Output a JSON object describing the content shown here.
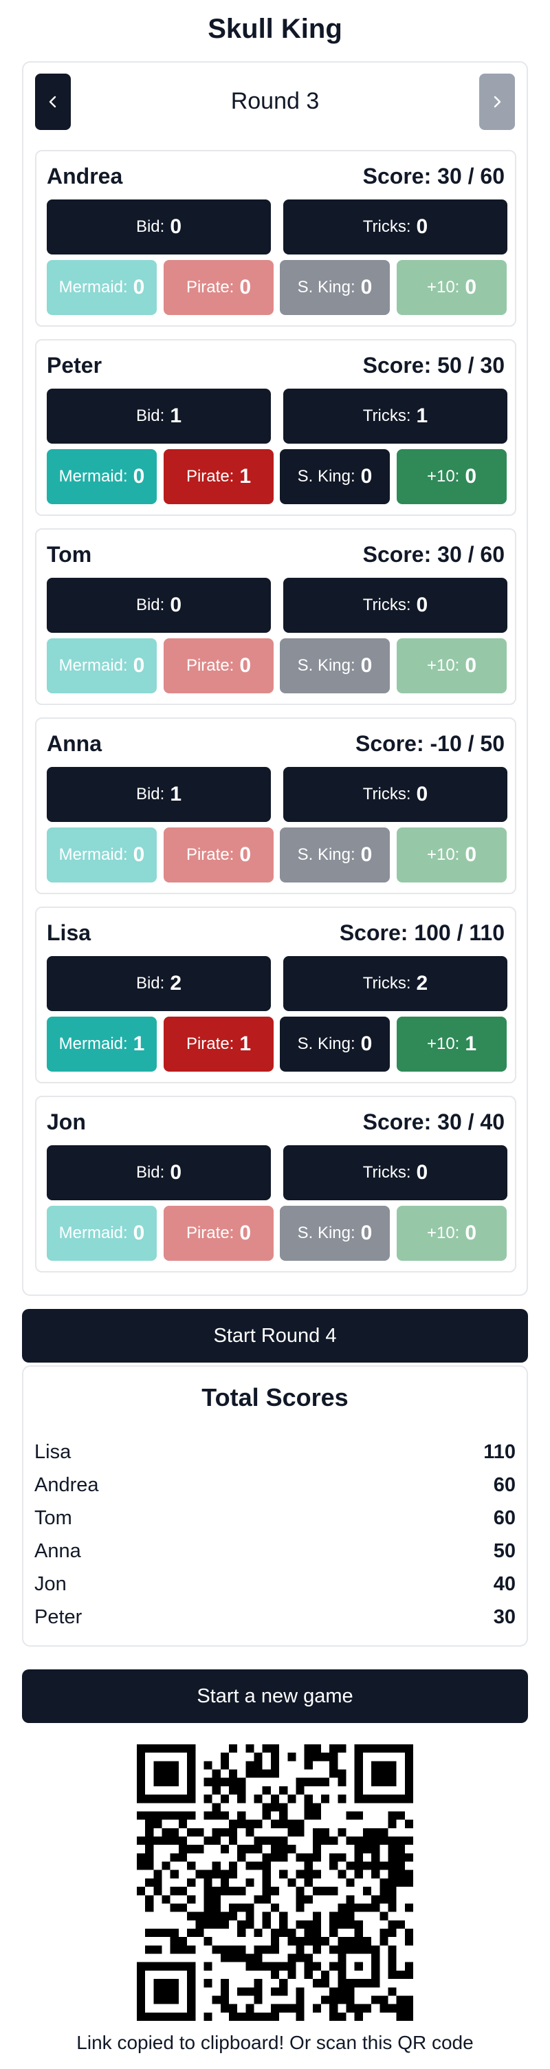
{
  "app": {
    "title": "Skull King"
  },
  "round": {
    "title": "Round 3",
    "prev_icon": "chevron-left-icon",
    "next_icon": "chevron-right-icon"
  },
  "labels": {
    "bid": "Bid:",
    "tricks": "Tricks:",
    "mermaid": "Mermaid:",
    "pirate": "Pirate:",
    "sking": "S. King:",
    "plus10": "+10:"
  },
  "players": [
    {
      "name": "Andrea",
      "score": "Score: 30 / 60",
      "bid": "0",
      "tricks": "0",
      "mermaid": "0",
      "pirate": "0",
      "sking": "0",
      "plus10": "0"
    },
    {
      "name": "Peter",
      "score": "Score: 50 / 30",
      "bid": "1",
      "tricks": "1",
      "mermaid": "0",
      "pirate": "1",
      "sking": "0",
      "plus10": "0"
    },
    {
      "name": "Tom",
      "score": "Score: 30 / 60",
      "bid": "0",
      "tricks": "0",
      "mermaid": "0",
      "pirate": "0",
      "sking": "0",
      "plus10": "0"
    },
    {
      "name": "Anna",
      "score": "Score: -10 / 50",
      "bid": "1",
      "tricks": "0",
      "mermaid": "0",
      "pirate": "0",
      "sking": "0",
      "plus10": "0"
    },
    {
      "name": "Lisa",
      "score": "Score: 100 / 110",
      "bid": "2",
      "tricks": "2",
      "mermaid": "1",
      "pirate": "1",
      "sking": "0",
      "plus10": "1"
    },
    {
      "name": "Jon",
      "score": "Score: 30 / 40",
      "bid": "0",
      "tricks": "0",
      "mermaid": "0",
      "pirate": "0",
      "sking": "0",
      "plus10": "0"
    }
  ],
  "toggle_state": [
    {
      "mermaid": false,
      "pirate": false,
      "sking": false,
      "plus10": false
    },
    {
      "mermaid": true,
      "pirate": true,
      "sking": true,
      "plus10": true
    },
    {
      "mermaid": false,
      "pirate": false,
      "sking": false,
      "plus10": false
    },
    {
      "mermaid": false,
      "pirate": false,
      "sking": false,
      "plus10": false
    },
    {
      "mermaid": true,
      "pirate": true,
      "sking": true,
      "plus10": true
    },
    {
      "mermaid": false,
      "pirate": false,
      "sking": false,
      "plus10": false
    }
  ],
  "start_round_label": "Start Round 4",
  "totals": {
    "title": "Total Scores",
    "rows": [
      {
        "name": "Lisa",
        "value": "110"
      },
      {
        "name": "Andrea",
        "value": "60"
      },
      {
        "name": "Tom",
        "value": "60"
      },
      {
        "name": "Anna",
        "value": "50"
      },
      {
        "name": "Jon",
        "value": "40"
      },
      {
        "name": "Peter",
        "value": "30"
      }
    ]
  },
  "new_game_label": "Start a new game",
  "qr_caption": "Link copied to clipboard! Or scan this QR code",
  "colors": {
    "dark": "#111827",
    "mermaid_on": "#21b0a8",
    "mermaid_off": "#8dd9d4",
    "pirate_on": "#b91c1c",
    "pirate_off": "#de8a8a",
    "sking_on": "#111827",
    "sking_off": "#8a8f98",
    "plus10_on": "#2f8a57",
    "plus10_off": "#96c8a7"
  }
}
